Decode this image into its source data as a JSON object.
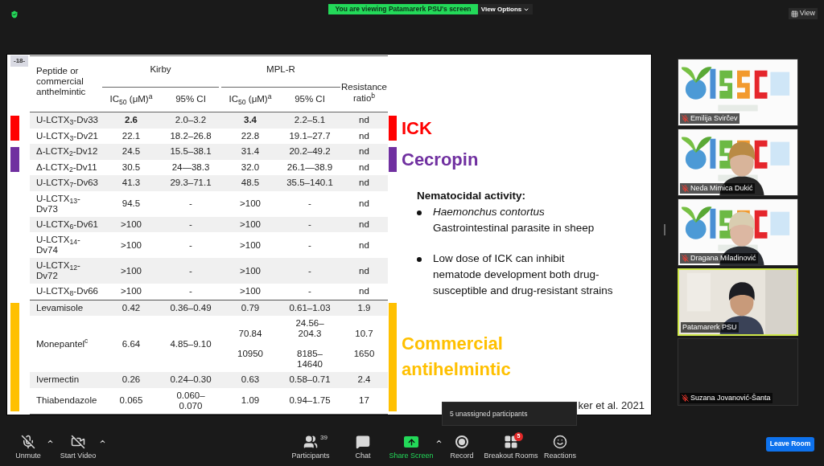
{
  "top_bar": {
    "share_banner": "You are viewing Patamarerk PSU's screen",
    "view_options": "View Options",
    "view_button": "View"
  },
  "slide": {
    "page_label": "-18-",
    "table": {
      "first_header": "Peptide or commercial anthelmintic",
      "groups": [
        {
          "label": "Kirby",
          "columns": [
            "IC$_{50}$ (μM)$^{a}$",
            "95% CI"
          ]
        },
        {
          "label": "MPL-R",
          "columns": [
            "IC$_{50}$ (μM)$^{a}$",
            "95% CI"
          ]
        }
      ],
      "last_header": "Resistance ratio$^{b}$",
      "sections": [
        {
          "label": "ICK",
          "color": "#ff0000",
          "divider_above": false,
          "rows": [
            {
              "cells": [
                "U-LCTX$_{3}$-Dv33",
                {
                  "text": "2.6",
                  "bold": true
                },
                "2.0–3.2",
                {
                  "text": "3.4",
                  "bold": true
                },
                "2.2–5.1",
                "nd"
              ]
            },
            {
              "cells": [
                "U-LCTX$_{3}$-Dv21",
                "22.1",
                "18.2–26.8",
                "22.8",
                "19.1–27.7",
                "nd"
              ]
            }
          ]
        },
        {
          "label": "Cecropin",
          "color": "#7030a0",
          "divider_above": false,
          "rows": [
            {
              "cells": [
                "Δ-LCTX$_{2}$-Dv12",
                "24.5",
                "15.5–38.1",
                "31.4",
                "20.2–49.2",
                "nd"
              ]
            },
            {
              "cells": [
                "Δ-LCTX$_{2}$-Dv11",
                "30.5",
                "24—38.3",
                "32.0",
                "26.1—38.9",
                "nd"
              ]
            }
          ]
        },
        {
          "divider_above": false,
          "rows": [
            {
              "cells": [
                "U-LCTX$_{7}$-Dv63",
                "41.3",
                "29.3–71.1",
                "48.5",
                "35.5–140.1",
                "nd"
              ]
            },
            {
              "cells": [
                "U-LCTX$_{13}$-Dv73",
                "94.5",
                "-",
                ">100",
                "-",
                "nd"
              ]
            },
            {
              "cells": [
                "U-LCTX$_{6}$-Dv61",
                ">100",
                "-",
                ">100",
                "-",
                "nd"
              ]
            },
            {
              "cells": [
                "U-LCTX$_{14}$-Dv74",
                ">100",
                "-",
                ">100",
                "-",
                "nd"
              ]
            },
            {
              "cells": [
                "U-LCTX$_{12}$-Dv72",
                ">100",
                "-",
                ">100",
                "-",
                "nd"
              ]
            },
            {
              "cells": [
                "U-LCTX$_{8}$-Dv66",
                ">100",
                "-",
                ">100",
                "-",
                "nd"
              ]
            }
          ]
        },
        {
          "label": "Commercial antihelmintic",
          "color": "#ffc000",
          "divider_above": true,
          "rows": [
            {
              "cells": [
                "Levamisole",
                "0.42",
                "0.36–0.49",
                "0.79",
                "0.61–1.03",
                "1.9"
              ]
            },
            {
              "cells": [
                "Monepantel$^{c}$",
                "6.64",
                "4.85–9.10",
                {
                  "lines": [
                    "70.84",
                    "10950"
                  ]
                },
                {
                  "lines": [
                    {
                      "text": "24.56–204.3",
                      "wrapped": true
                    },
                    {
                      "text": "8185–14640",
                      "wrapped": true
                    }
                  ]
                },
                {
                  "lines": [
                    "10.7",
                    "1650"
                  ]
                }
              ]
            },
            {
              "cells": [
                "Ivermectin",
                "0.26",
                "0.24–0.30",
                "0.63",
                "0.58–0.71",
                "2.4"
              ]
            },
            {
              "cells": [
                "Thiabendazole",
                "0.065",
                {
                  "text": "0.060–0.070",
                  "wrapped": true
                },
                "1.09",
                "0.94–1.75",
                "17"
              ]
            }
          ]
        }
      ]
    },
    "notes": {
      "heading": "Nematocidal activity:",
      "bullets": [
        {
          "title": "Haemonchus contortus",
          "text": "Gastrointestinal parasite in sheep"
        },
        {
          "text": "Low dose of ICK can inhibit nematode development both drug-susceptible and drug-resistant strains"
        }
      ]
    },
    "citation": "ker et al. 2021"
  },
  "gallery": [
    {
      "name": "Emilija Svirčev",
      "muted": true,
      "speaking": false,
      "kind": "logo"
    },
    {
      "name": "Neda Mimica Dukić",
      "muted": true,
      "speaking": false,
      "kind": "logo_person"
    },
    {
      "name": "Dragana Miladinović",
      "muted": true,
      "speaking": false,
      "kind": "logo_person_light"
    },
    {
      "name": "Patamarerk PSU",
      "muted": false,
      "speaking": true,
      "kind": "room_person"
    },
    {
      "name": "Suzana Jovanović-Šanta",
      "muted": true,
      "speaking": false,
      "kind": "none"
    }
  ],
  "toolbar": {
    "items": [
      {
        "label": "Unmute",
        "kind": "mic",
        "off": true,
        "has_menu": true
      },
      {
        "label": "Start Video",
        "kind": "video",
        "off": true,
        "has_menu": true
      },
      {
        "label": "Participants",
        "kind": "participants",
        "count": "39"
      },
      {
        "label": "Chat",
        "kind": "chat"
      },
      {
        "label": "Share Screen",
        "kind": "share",
        "has_menu": true
      },
      {
        "label": "Record",
        "kind": "record"
      },
      {
        "label": "Breakout Rooms",
        "kind": "breakout",
        "badge": "5"
      },
      {
        "label": "Reactions",
        "kind": "reactions"
      }
    ],
    "leave": "Leave Room",
    "tooltip": "5 unassigned participants"
  }
}
